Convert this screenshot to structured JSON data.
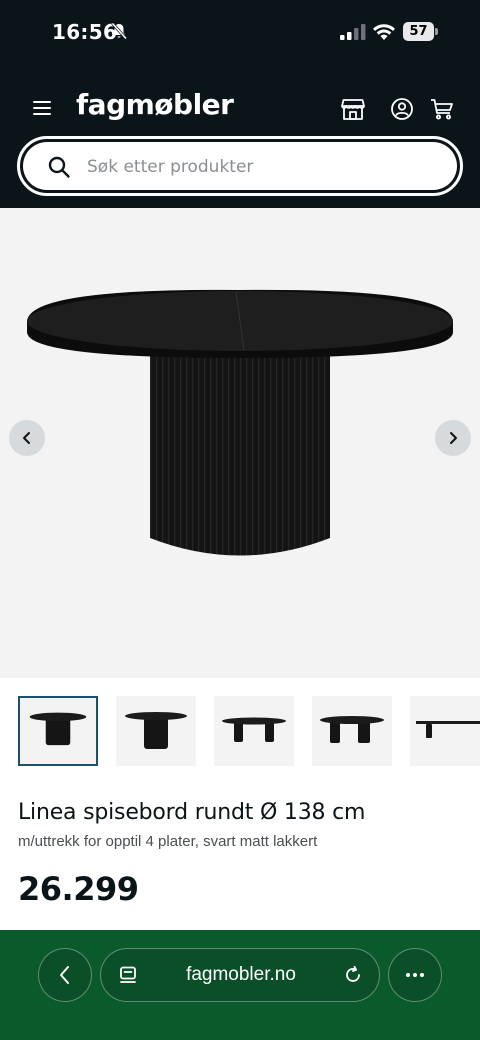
{
  "status_bar": {
    "time": "16:56",
    "battery": "57",
    "icons": [
      "bell-off-icon",
      "signal-icon",
      "wifi-icon",
      "battery-icon"
    ]
  },
  "header": {
    "logo": "fagmøbler",
    "icons": [
      "menu-icon",
      "store-icon",
      "account-icon",
      "cart-icon"
    ],
    "background": "#0b1418"
  },
  "search": {
    "placeholder": "Søk etter produkter",
    "value": ""
  },
  "gallery": {
    "icons": [
      "chevron-left-icon",
      "chevron-right-icon"
    ],
    "thumbnail_count": 5,
    "active_thumbnail": 1
  },
  "product": {
    "title": "Linea spisebord rundt Ø 138 cm",
    "subtitle": "m/uttrekk for opptil 4 plater, svart matt lakkert",
    "price": "26.299"
  },
  "browser": {
    "url": "fagmobler.no",
    "icons": [
      "back-icon",
      "tabs-icon",
      "reload-icon",
      "more-icon"
    ],
    "background": "#0b5a2c"
  }
}
